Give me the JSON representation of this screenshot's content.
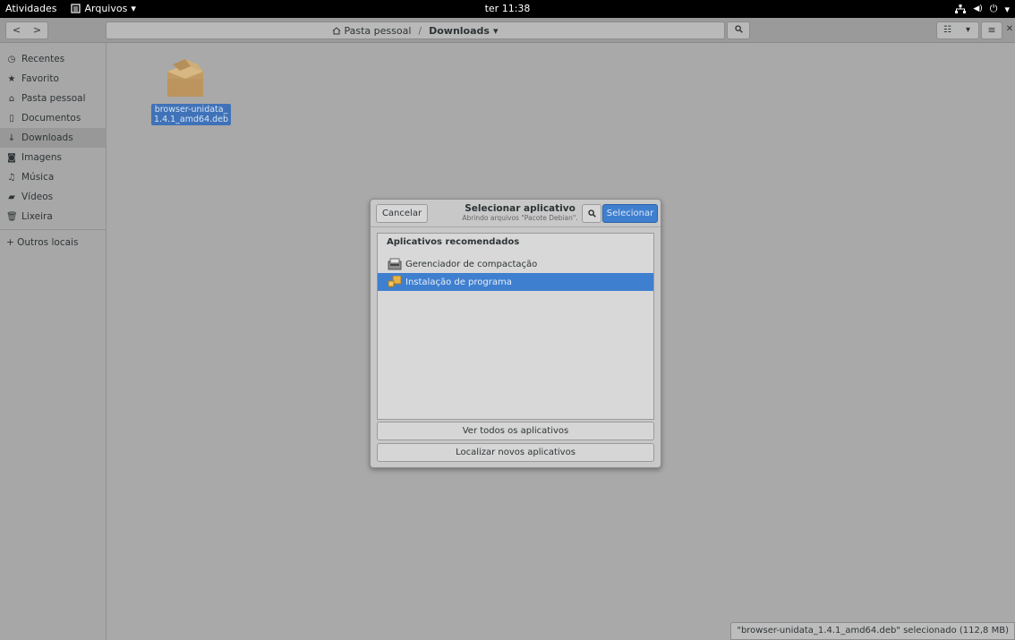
{
  "topbar": {
    "activities": "Atividades",
    "app_name": "Arquivos",
    "clock": "ter 11:38"
  },
  "header": {
    "back": "<",
    "forward": ">",
    "path_home": "Pasta pessoal",
    "path_separator": "/",
    "path_current": "Downloads"
  },
  "sidebar": {
    "items": [
      {
        "label": "Recentes",
        "icon": "clock-icon"
      },
      {
        "label": "Favorito",
        "icon": "star-icon"
      },
      {
        "label": "Pasta pessoal",
        "icon": "home-icon"
      },
      {
        "label": "Documentos",
        "icon": "document-icon"
      },
      {
        "label": "Downloads",
        "icon": "download-icon",
        "active": true
      },
      {
        "label": "Imagens",
        "icon": "camera-icon"
      },
      {
        "label": "Música",
        "icon": "music-icon"
      },
      {
        "label": "Vídeos",
        "icon": "video-icon"
      },
      {
        "label": "Lixeira",
        "icon": "trash-icon"
      }
    ],
    "other_locations": "+ Outros locais"
  },
  "file": {
    "name_line1": "browser-unidata_",
    "name_line2": "1.4.1_amd64.deb"
  },
  "dialog": {
    "cancel": "Cancelar",
    "title": "Selecionar aplicativo",
    "subtitle": "Abrindo arquivos \"Pacote Debian\".",
    "select": "Selecionar",
    "section_header": "Aplicativos recomendados",
    "apps": [
      {
        "label": "Gerenciador de compactação",
        "icon": "archive-manager-icon",
        "selected": false
      },
      {
        "label": "Instalação de programa",
        "icon": "package-installer-icon",
        "selected": true
      }
    ],
    "view_all": "Ver todos os aplicativos",
    "find_new": "Localizar novos aplicativos"
  },
  "statusbar": {
    "text": "\"browser-unidata_1.4.1_amd64.deb\" selecionado (112,8 MB)"
  },
  "colors": {
    "accent": "#3f7fcf",
    "topbar": "#000000"
  }
}
